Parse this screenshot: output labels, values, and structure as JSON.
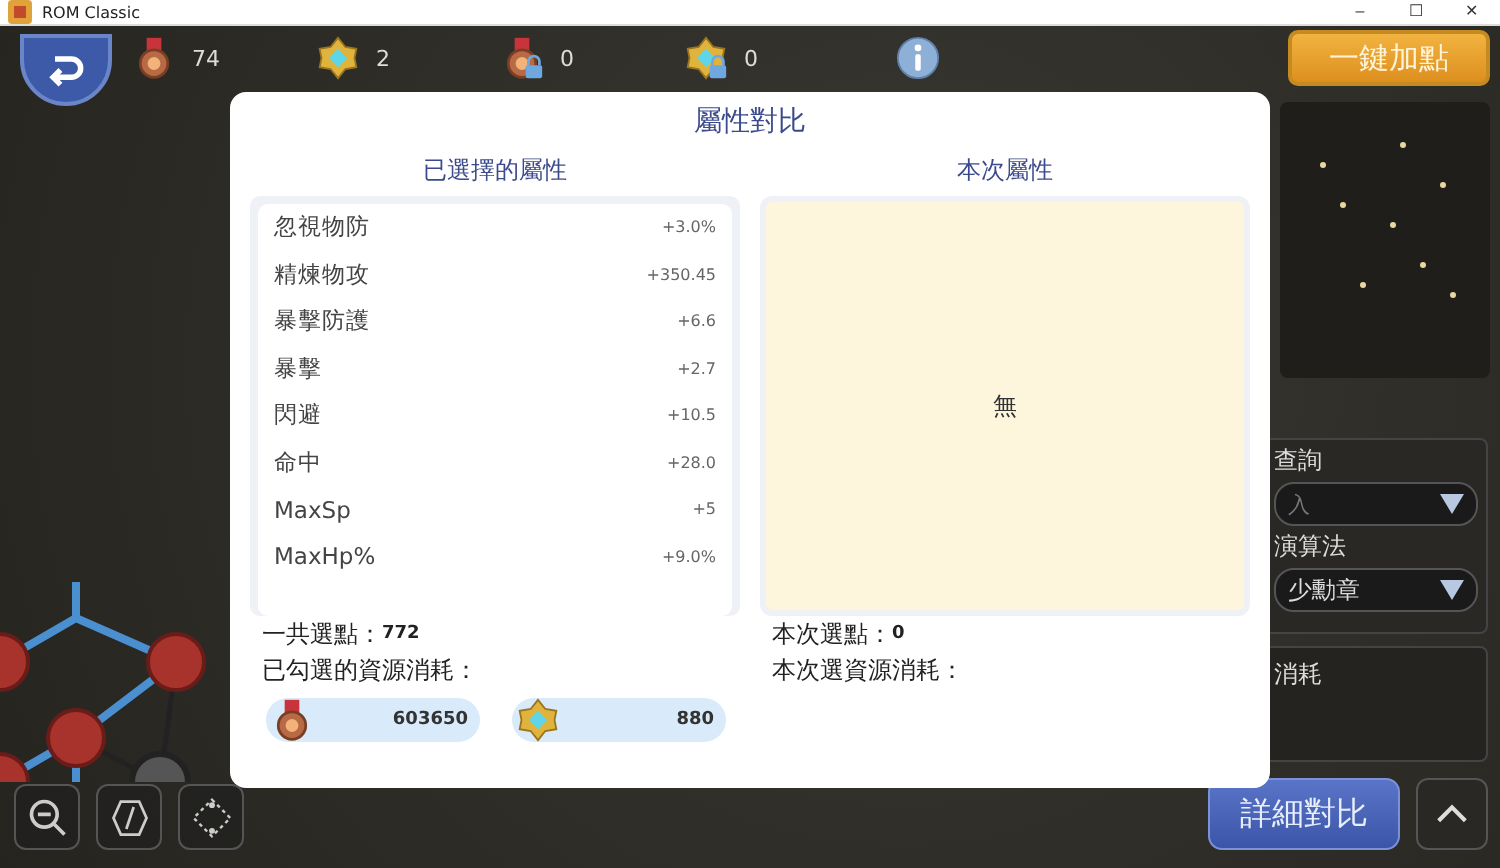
{
  "window": {
    "title": "ROM Classic",
    "controls": [
      "–",
      "☐",
      "✕"
    ]
  },
  "top_bar": {
    "resources": [
      {
        "kind": "medal",
        "locked": false,
        "count": "74"
      },
      {
        "kind": "gear",
        "locked": false,
        "count": "2"
      },
      {
        "kind": "medal",
        "locked": true,
        "count": "0"
      },
      {
        "kind": "gear",
        "locked": true,
        "count": "0"
      }
    ],
    "auto_add_button": "一鍵加點"
  },
  "side_panel": {
    "search_label": "查詢",
    "search_placeholder": "入",
    "algorithm_label": "演算法",
    "algorithm_value": "少勳章",
    "cost_label": "消耗"
  },
  "dialog": {
    "title": "屬性對比",
    "selected_column": {
      "heading": "已選擇的屬性",
      "attributes": [
        {
          "name": "忽視物防",
          "value": "+3.0%"
        },
        {
          "name": "精煉物攻",
          "value": "+350.45"
        },
        {
          "name": "暴擊防護",
          "value": "+6.6"
        },
        {
          "name": "暴擊",
          "value": "+2.7"
        },
        {
          "name": "閃避",
          "value": "+10.5"
        },
        {
          "name": "命中",
          "value": "+28.0"
        },
        {
          "name": "MaxSp",
          "value": "+5"
        },
        {
          "name": "MaxHp%",
          "value": "+9.0%"
        }
      ],
      "total_label": "一共選點：",
      "total_value": "772",
      "cost_label": "已勾選的資源消耗：",
      "costs": [
        {
          "kind": "medal",
          "amount": "603650"
        },
        {
          "kind": "gear",
          "amount": "880"
        }
      ]
    },
    "current_column": {
      "heading": "本次屬性",
      "empty_text": "無",
      "total_label": "本次選點：",
      "total_value": "0",
      "cost_label": "本次選資源消耗："
    }
  },
  "bottom": {
    "compare_button": "詳細對比"
  }
}
